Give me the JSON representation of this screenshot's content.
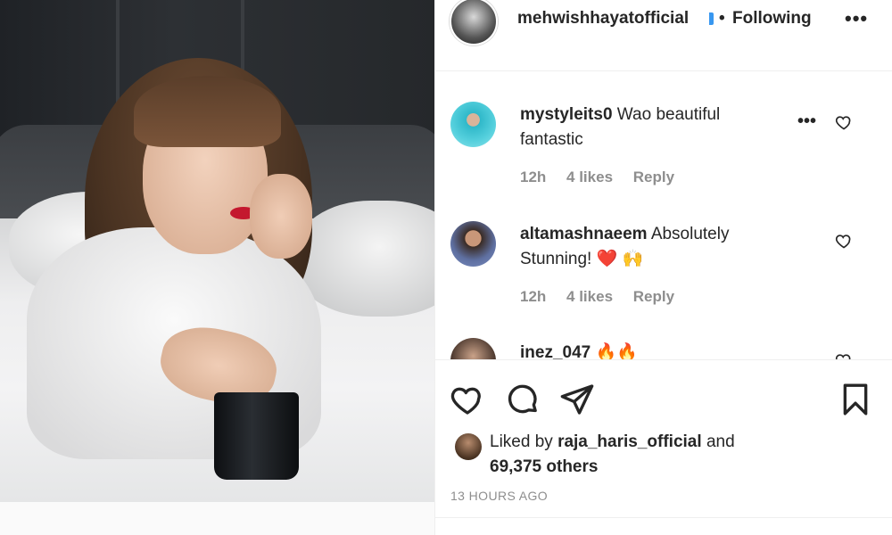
{
  "post": {
    "author": "mehwishhayatofficial",
    "follow_state": "Following",
    "separator": "•"
  },
  "comments": [
    {
      "username": "mystyleits0",
      "text": "Wao beautiful fantastic",
      "time": "12h",
      "likes": "4 likes",
      "reply": "Reply"
    },
    {
      "username": "altamashnaeem",
      "text": "Absolutely Stunning! ❤️ 🙌",
      "time": "12h",
      "likes": "4 likes",
      "reply": "Reply"
    },
    {
      "username": "inez_047",
      "text": "🔥🔥"
    }
  ],
  "likes": {
    "prefix": "Liked by",
    "user": "raja_haris_official",
    "and": "and",
    "others": "69,375 others"
  },
  "timestamp": "13 HOURS AGO",
  "icons": {
    "like": "heart-outline-icon",
    "comment": "comment-bubble-icon",
    "share": "paper-plane-icon",
    "save": "bookmark-icon",
    "more": "more-horizontal-icon"
  }
}
